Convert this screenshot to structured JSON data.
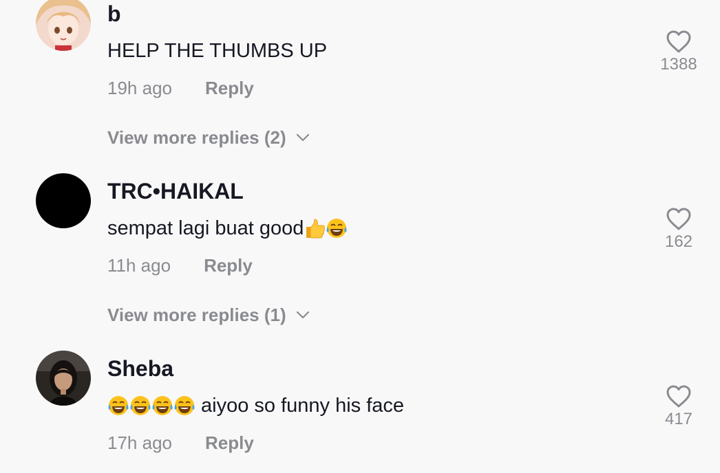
{
  "comments": [
    {
      "username": "b",
      "text": "HELP THE THUMBS UP",
      "emojis": [],
      "time": "19h ago",
      "reply_label": "Reply",
      "likes": "1388",
      "view_more": "View more replies (2)",
      "avatar": "anime-avatar"
    },
    {
      "username": "TRC•HAIKAL",
      "text": "sempat lagi buat good",
      "emojis": [
        "thumbs-up-emoji",
        "tears-of-joy-emoji"
      ],
      "time": "11h ago",
      "reply_label": "Reply",
      "likes": "162",
      "view_more": "View more replies (1)",
      "avatar": "black-avatar"
    },
    {
      "username": "Sheba",
      "text": "aiyoo so funny his face",
      "emojis": [
        "tears-of-joy-emoji",
        "tears-of-joy-emoji",
        "tears-of-joy-emoji",
        "tears-of-joy-emoji"
      ],
      "time": "17h ago",
      "reply_label": "Reply",
      "likes": "417",
      "avatar": "photo-avatar"
    }
  ],
  "colors": {
    "background": "#f8f8f8",
    "primary_text": "#161823",
    "secondary_text": "#8a8b91"
  }
}
